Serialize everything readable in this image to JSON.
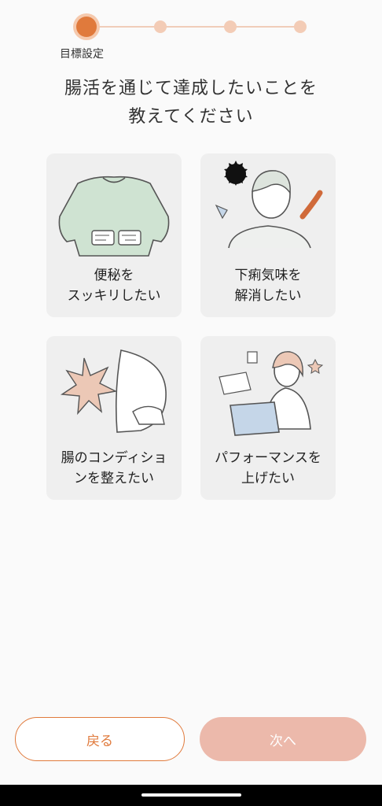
{
  "stepper": {
    "steps": 4,
    "current": 1,
    "current_label": "目標設定"
  },
  "title": "腸活を通じて達成したいことを\n教えてください",
  "goals": [
    {
      "label": "便秘を\nスッキリしたい",
      "icon": "sweater-belly-icon"
    },
    {
      "label": "下痢気味を\n解消したい",
      "icon": "person-food-icon"
    },
    {
      "label": "腸のコンディショ\nンを整えたい",
      "icon": "stomach-burst-icon"
    },
    {
      "label": "パフォーマンスを\n上げたい",
      "icon": "woman-laptop-icon"
    }
  ],
  "buttons": {
    "back": "戻る",
    "next": "次へ"
  },
  "colors": {
    "accent": "#e07a3c",
    "accent_light": "#ecb9ab",
    "card_bg": "#efefef"
  }
}
